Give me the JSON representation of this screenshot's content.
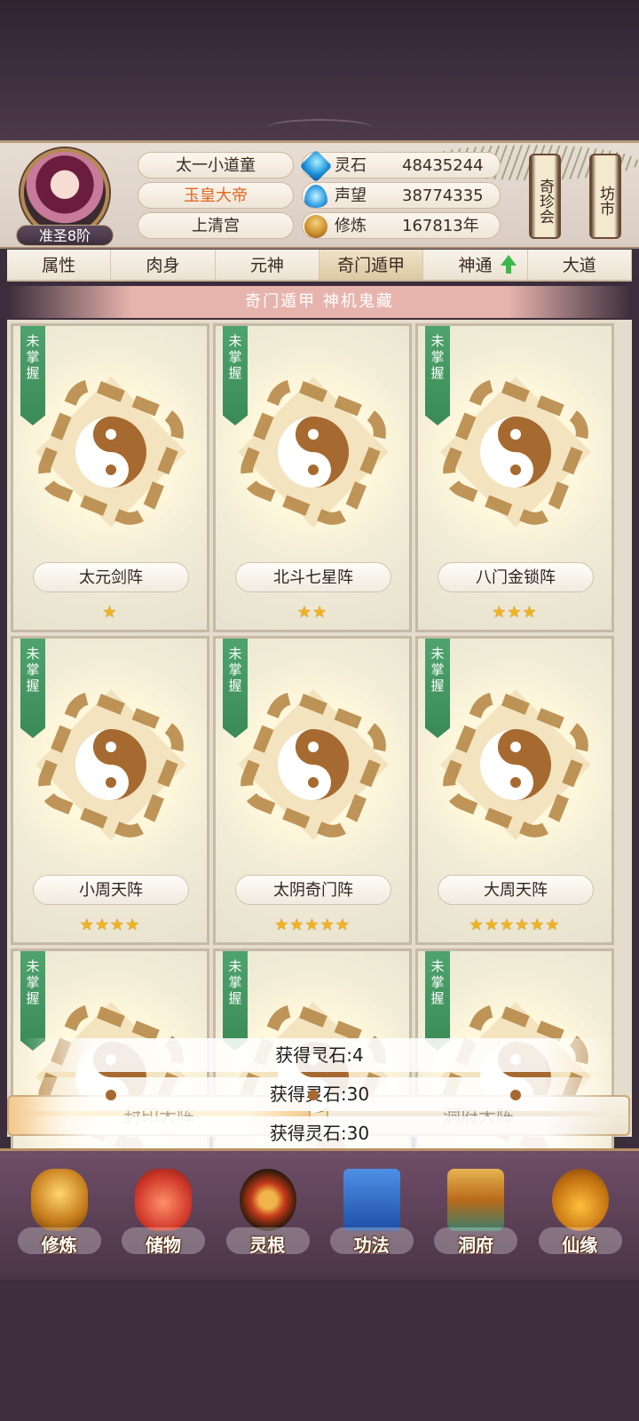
{
  "player": {
    "title": "太一小道童",
    "honor": "玉皇大帝",
    "sect": "上清宫",
    "rank": "准圣8阶"
  },
  "resources": [
    {
      "icon": "spirit-stone-icon",
      "label": "灵石",
      "value": "48435244"
    },
    {
      "icon": "reputation-icon",
      "label": "声望",
      "value": "38774335"
    },
    {
      "icon": "cultivation-icon",
      "label": "修炼",
      "value": "167813年"
    }
  ],
  "side_buttons": {
    "treasure": "奇珍会",
    "market": "坊市"
  },
  "tabs": [
    "属性",
    "肉身",
    "元神",
    "奇门遁甲",
    "神通",
    "大道"
  ],
  "active_tab": "奇门遁甲",
  "banner": "奇门遁甲 神机鬼藏",
  "cards": [
    {
      "status": "未掌握",
      "name": "太元剑阵",
      "stars": 1
    },
    {
      "status": "未掌握",
      "name": "北斗七星阵",
      "stars": 2
    },
    {
      "status": "未掌握",
      "name": "八门金锁阵",
      "stars": 3
    },
    {
      "status": "未掌握",
      "name": "小周天阵",
      "stars": 4
    },
    {
      "status": "未掌握",
      "name": "太阴奇门阵",
      "stars": 5
    },
    {
      "status": "未掌握",
      "name": "大周天阵",
      "stars": 6
    },
    {
      "status": "未掌握",
      "name": "",
      "stars": 0
    },
    {
      "status": "未掌握",
      "name": "",
      "stars": 0
    },
    {
      "status": "未掌握",
      "name": "",
      "stars": 0
    }
  ],
  "toasts": [
    "获得灵石:4",
    "获得灵石:30",
    "获得灵石:30"
  ],
  "actions": {
    "seal": "封印大阵",
    "cave": "洞府大阵"
  },
  "bottom_nav": [
    "修炼",
    "储物",
    "灵根",
    "功法",
    "洞府",
    "仙缘"
  ],
  "colors": {
    "accent": "#e2671f",
    "unlearned_tag": "#4fa36d",
    "star": "#f1b21c"
  }
}
